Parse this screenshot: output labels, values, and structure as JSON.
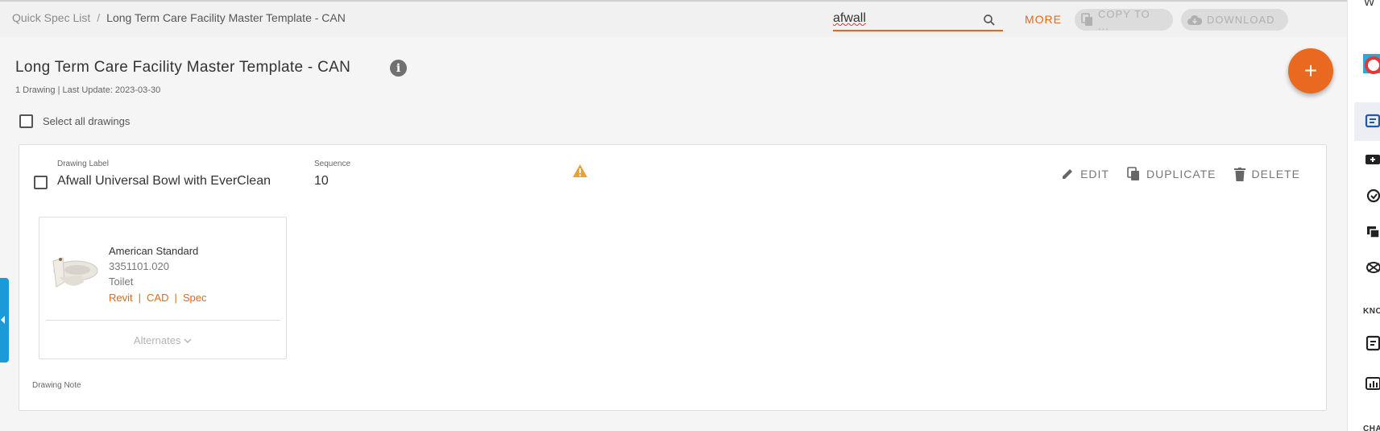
{
  "breadcrumb": {
    "parent": "Quick Spec List",
    "separator": "/",
    "current": "Long Term Care Facility Master Template - CAN"
  },
  "search": {
    "value": "afwall"
  },
  "toolbar": {
    "more_label": "MORE",
    "copy_label": "COPY TO ...",
    "download_label": "DOWNLOAD"
  },
  "header": {
    "title": "Long Term Care Facility Master Template - CAN",
    "info_glyph": "i",
    "meta": "1 Drawing | Last Update: 2023-03-30",
    "add_glyph": "+"
  },
  "select_all_label": "Select all drawings",
  "drawing": {
    "label_caption": "Drawing Label",
    "label_value": "Afwall Universal Bowl with EverClean",
    "sequence_caption": "Sequence",
    "sequence_value": "10",
    "actions": {
      "edit": "EDIT",
      "duplicate": "DUPLICATE",
      "delete": "DELETE"
    },
    "product": {
      "brand": "American Standard",
      "sku": "3351101.020",
      "type": "Toilet",
      "links": [
        "Revit",
        "CAD",
        "Spec"
      ],
      "link_separator": "|",
      "alternates_label": "Alternates"
    },
    "note_caption": "Drawing Note"
  },
  "rail": {
    "top_glyph": "W",
    "section_1": "KNO",
    "section_2": "CHA"
  },
  "colors": {
    "accent": "#e06a1b",
    "fab": "#e8691f",
    "warning": "#e9a13a",
    "handle": "#1a9ad6",
    "rail_icon": "#1e5aa8"
  },
  "icons": [
    "search-icon",
    "copy-icon",
    "cloud-download-icon",
    "info-icon",
    "add-icon",
    "warning-icon",
    "edit-icon",
    "duplicate-icon",
    "delete-icon",
    "chevron-down-icon",
    "lifebuoy-icon"
  ]
}
